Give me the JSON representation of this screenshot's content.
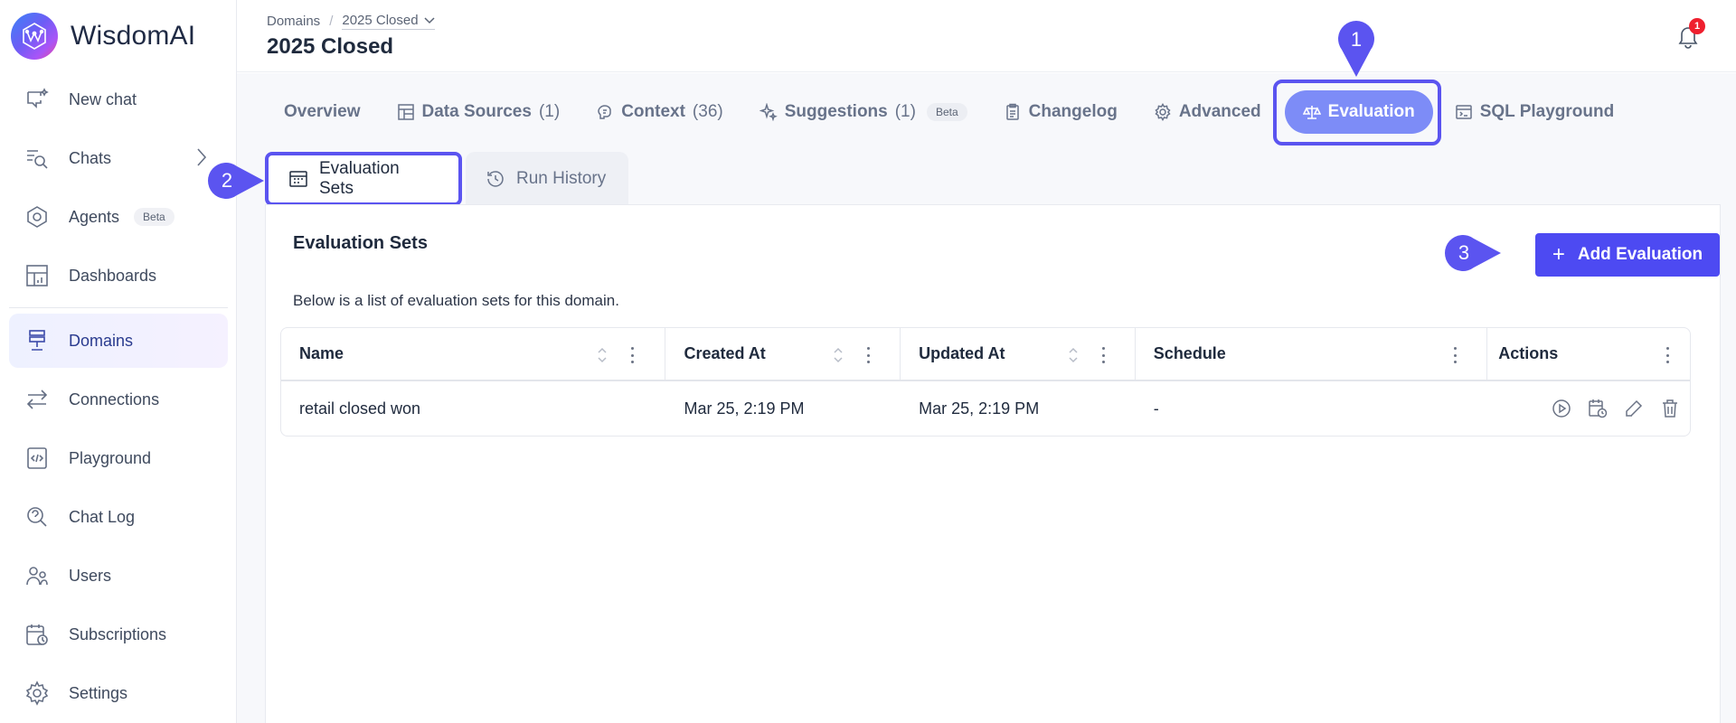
{
  "brand": {
    "name": "WisdomAI"
  },
  "sidebar": {
    "items": [
      {
        "label": "New chat",
        "icon": "new-chat-icon"
      },
      {
        "label": "Chats",
        "icon": "chats-search-icon"
      },
      {
        "label": "Agents",
        "icon": "agents-icon",
        "badge": "Beta"
      },
      {
        "label": "Dashboards",
        "icon": "dashboard-icon"
      },
      {
        "label": "Domains",
        "icon": "domains-icon",
        "active": true
      },
      {
        "label": "Connections",
        "icon": "connections-icon"
      },
      {
        "label": "Playground",
        "icon": "playground-icon"
      },
      {
        "label": "Chat Log",
        "icon": "chat-log-icon"
      },
      {
        "label": "Users",
        "icon": "users-icon"
      },
      {
        "label": "Subscriptions",
        "icon": "subscriptions-icon"
      },
      {
        "label": "Settings",
        "icon": "settings-icon"
      }
    ]
  },
  "header": {
    "breadcrumb": {
      "root": "Domains",
      "separator": "/",
      "current": "2025 Closed"
    },
    "title": "2025 Closed",
    "notifications": {
      "count": "1"
    }
  },
  "tabs": [
    {
      "label": "Overview",
      "icon": ""
    },
    {
      "label": "Data Sources",
      "count": "(1)",
      "icon": "data-sources-icon"
    },
    {
      "label": "Context",
      "count": "(36)",
      "icon": "context-icon"
    },
    {
      "label": "Suggestions",
      "count": "(1)",
      "badge": "Beta",
      "icon": "sparkle-icon"
    },
    {
      "label": "Changelog",
      "icon": "clipboard-icon"
    },
    {
      "label": "Advanced",
      "icon": "gear-icon"
    },
    {
      "label": "Evaluation",
      "icon": "scale-icon",
      "active": true
    },
    {
      "label": "SQL Playground",
      "icon": "sql-icon"
    }
  ],
  "subtabs": [
    {
      "label": "Evaluation Sets",
      "icon": "calendar-grid-icon",
      "active": true
    },
    {
      "label": "Run History",
      "icon": "history-icon"
    }
  ],
  "callouts": [
    "1",
    "2",
    "3"
  ],
  "card": {
    "title": "Evaluation Sets",
    "description": "Below is a list of evaluation sets for this domain.",
    "add_button": {
      "plus": "+",
      "label": "Add Evaluation"
    }
  },
  "table": {
    "headers": [
      "Name",
      "Created At",
      "Updated At",
      "Schedule",
      "Actions"
    ],
    "rows": [
      {
        "name": "retail closed won",
        "created": "Mar 25, 2:19 PM",
        "updated": "Mar 25, 2:19 PM",
        "schedule": "-"
      }
    ],
    "row_actions": [
      "run-icon",
      "schedule-icon",
      "edit-icon",
      "delete-icon"
    ]
  },
  "colors": {
    "accent": "#4d4af2",
    "active_tab": "#7d8cf7",
    "highlight": "#5b54f0",
    "badge": "#ef1f2e"
  }
}
